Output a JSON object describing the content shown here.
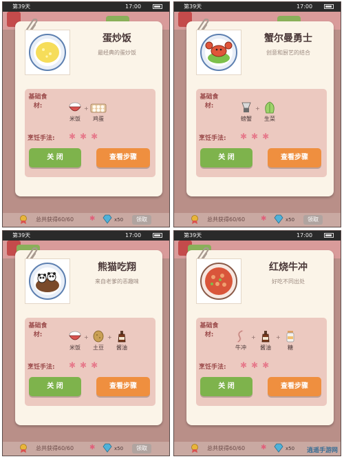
{
  "game": {
    "day": "第39天",
    "time": "17:00",
    "total_label": "总共获得60/60",
    "gem_count": "x50",
    "claim_label": "领取"
  },
  "labels": {
    "basic_ingredients": "基础食材:",
    "cooking_method": "烹饪手法:",
    "close": "关 闭",
    "view_steps": "查看步骤"
  },
  "cards": [
    {
      "dish": "蛋炒饭",
      "desc": "最经典的蛋炒饭",
      "ingredients": [
        "米饭",
        "鸡蛋"
      ],
      "stars": "✱✱✱"
    },
    {
      "dish": "蟹尔曼勇士",
      "desc": "创意和厨艺的结合",
      "ingredients": [
        "螃蟹",
        "生菜"
      ],
      "stars": "✱✱✱"
    },
    {
      "dish": "熊猫吃翔",
      "desc": "来自老爹的恶趣味",
      "ingredients": [
        "米饭",
        "土豆",
        "酱油"
      ],
      "stars": "✱✱✱"
    },
    {
      "dish": "红烧牛冲",
      "desc": "好吃不同出处",
      "ingredients": [
        "牛冲",
        "酱油",
        "糖"
      ],
      "stars": "✱✱✱"
    }
  ],
  "watermark": "逍遥手游网"
}
